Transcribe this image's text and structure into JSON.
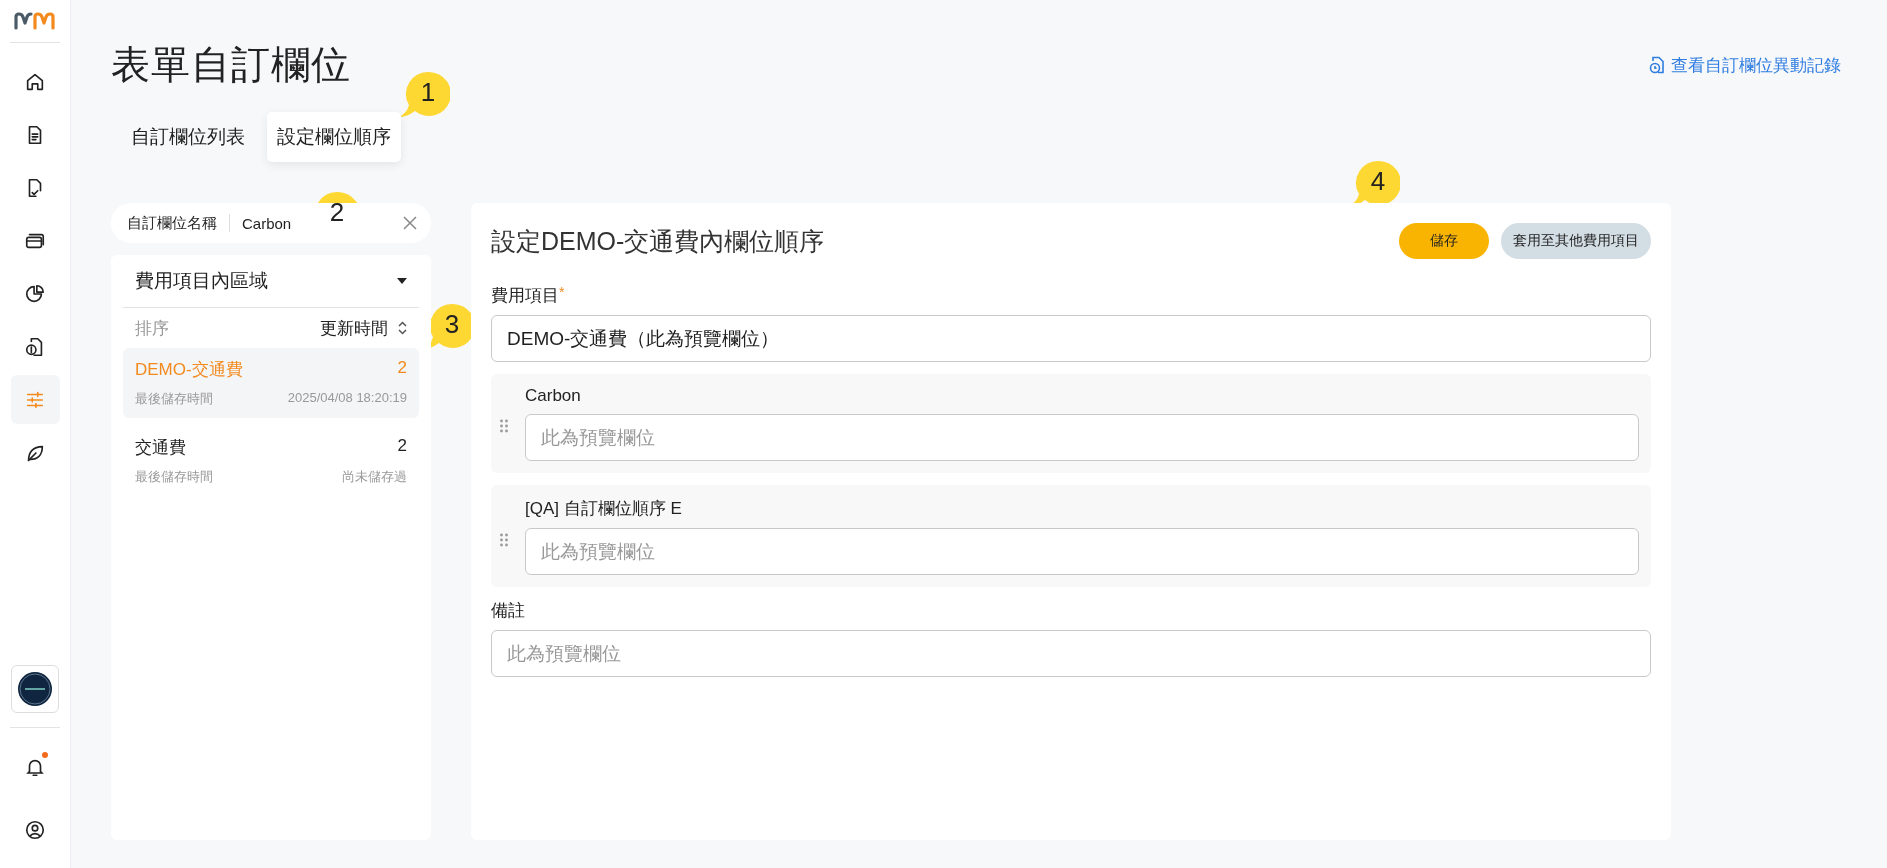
{
  "sidebar": {
    "items": [
      {
        "kind": "home",
        "selected": false
      },
      {
        "kind": "document",
        "selected": false
      },
      {
        "kind": "document-check",
        "selected": false
      },
      {
        "kind": "cards",
        "selected": false
      },
      {
        "kind": "pie",
        "selected": false
      },
      {
        "kind": "money-document",
        "selected": false
      },
      {
        "kind": "sliders",
        "selected": true
      },
      {
        "kind": "leaf",
        "selected": false
      }
    ],
    "notification_dot": true
  },
  "header": {
    "title": "表單自訂欄位",
    "link": "查看自訂欄位異動記錄"
  },
  "tabs": [
    {
      "label": "自訂欄位列表",
      "selected": false
    },
    {
      "label": "設定欄位順序",
      "selected": true
    }
  ],
  "filter": {
    "label": "自訂欄位名稱",
    "value": "Carbon"
  },
  "panel": {
    "dropdown": "費用項目內區域",
    "sort_label": "排序",
    "sort_value": "更新時間",
    "items": [
      {
        "name": "DEMO-交通費",
        "count": "2",
        "meta_label": "最後儲存時間",
        "meta_value": "2025/04/08 18:20:19",
        "selected": true
      },
      {
        "name": "交通費",
        "count": "2",
        "meta_label": "最後儲存時間",
        "meta_value": "尚未儲存過",
        "selected": false
      }
    ]
  },
  "editor": {
    "title": "設定DEMO-交通費內欄位順序",
    "buttons": [
      {
        "label": "儲存",
        "kind": "primary"
      },
      {
        "label": "套用至其他費用項目",
        "kind": "secondary"
      }
    ],
    "fields": [
      {
        "kind": "fixed",
        "label": "費用項目",
        "required_mark": "*",
        "value": "DEMO-交通費（此為預覽欄位）"
      },
      {
        "kind": "draggable",
        "label": "Carbon",
        "placeholder": "此為預覽欄位"
      },
      {
        "kind": "draggable",
        "label": "[QA] 自訂欄位順序 E",
        "placeholder": "此為預覽欄位"
      },
      {
        "kind": "fixed",
        "label": "備註",
        "placeholder": "此為預覽欄位"
      }
    ]
  },
  "callouts": [
    {
      "text": "1"
    },
    {
      "text": "2"
    },
    {
      "text": "3"
    },
    {
      "text": "4"
    }
  ]
}
